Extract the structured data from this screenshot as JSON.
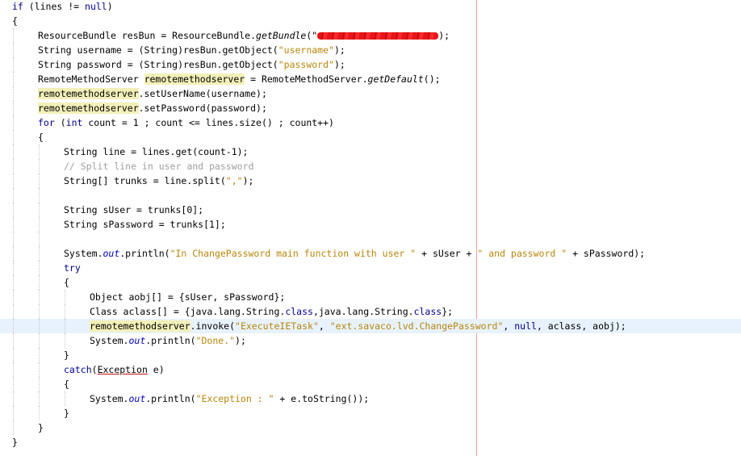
{
  "editor": {
    "lines": [
      {
        "indent": 0,
        "parts": [
          {
            "k": "kw",
            "t": "if"
          },
          {
            "k": "",
            "t": " (lines != "
          },
          {
            "k": "kw",
            "t": "null"
          },
          {
            "k": "",
            "t": ")"
          }
        ]
      },
      {
        "indent": 0,
        "parts": [
          {
            "k": "",
            "t": "{"
          }
        ]
      },
      {
        "indent": 1,
        "parts": [
          {
            "k": "",
            "t": "ResourceBundle resBun = ResourceBundle."
          },
          {
            "k": "it",
            "t": "getBundle"
          },
          {
            "k": "",
            "t": "(\""
          },
          {
            "k": "redact",
            "t": ""
          },
          {
            "k": "",
            "t": ");"
          }
        ]
      },
      {
        "indent": 1,
        "parts": [
          {
            "k": "",
            "t": "String username = (String)resBun.getObject("
          },
          {
            "k": "str",
            "t": "\"username\""
          },
          {
            "k": "",
            "t": ");"
          }
        ]
      },
      {
        "indent": 1,
        "parts": [
          {
            "k": "",
            "t": "String password = (String)resBun.getObject("
          },
          {
            "k": "str",
            "t": "\"password\""
          },
          {
            "k": "",
            "t": ");"
          }
        ]
      },
      {
        "indent": 1,
        "parts": [
          {
            "k": "",
            "t": "RemoteMethodServer "
          },
          {
            "k": "occ",
            "t": "remotemethodserver"
          },
          {
            "k": "",
            "t": " = RemoteMethodServer."
          },
          {
            "k": "it",
            "t": "getDefault"
          },
          {
            "k": "",
            "t": "();"
          }
        ]
      },
      {
        "indent": 1,
        "parts": [
          {
            "k": "occ",
            "t": "remotemethodserver"
          },
          {
            "k": "",
            "t": ".setUserName(username);"
          }
        ]
      },
      {
        "indent": 1,
        "parts": [
          {
            "k": "occ",
            "t": "remotemethodserver"
          },
          {
            "k": "",
            "t": ".setPassword(password);"
          }
        ]
      },
      {
        "indent": 1,
        "parts": [
          {
            "k": "kw",
            "t": "for"
          },
          {
            "k": "",
            "t": " ("
          },
          {
            "k": "kw",
            "t": "int"
          },
          {
            "k": "",
            "t": " count = 1 ; count <= lines.size() ; count++)"
          }
        ]
      },
      {
        "indent": 1,
        "parts": [
          {
            "k": "",
            "t": "{"
          }
        ]
      },
      {
        "indent": 2,
        "parts": [
          {
            "k": "",
            "t": "String line = lines.get(count-1);"
          }
        ]
      },
      {
        "indent": 2,
        "parts": [
          {
            "k": "cmt",
            "t": "// Split line in user and password"
          }
        ]
      },
      {
        "indent": 2,
        "parts": [
          {
            "k": "",
            "t": "String[] trunks = line.split("
          },
          {
            "k": "str",
            "t": "\",\""
          },
          {
            "k": "",
            "t": ");"
          }
        ]
      },
      {
        "indent": 2,
        "parts": [
          {
            "k": "",
            "t": ""
          }
        ]
      },
      {
        "indent": 2,
        "parts": [
          {
            "k": "",
            "t": "String sUser = trunks[0];"
          }
        ]
      },
      {
        "indent": 2,
        "parts": [
          {
            "k": "",
            "t": "String sPassword = trunks[1];"
          }
        ]
      },
      {
        "indent": 2,
        "parts": [
          {
            "k": "",
            "t": ""
          }
        ]
      },
      {
        "indent": 2,
        "parts": [
          {
            "k": "",
            "t": "System."
          },
          {
            "k": "fld",
            "t": "out"
          },
          {
            "k": "",
            "t": ".println("
          },
          {
            "k": "str",
            "t": "\"In ChangePassword main function with user \""
          },
          {
            "k": "",
            "t": " + sUser + "
          },
          {
            "k": "str",
            "t": "\" and password \""
          },
          {
            "k": "",
            "t": " + sPassword);"
          }
        ]
      },
      {
        "indent": 2,
        "parts": [
          {
            "k": "kw",
            "t": "try"
          }
        ]
      },
      {
        "indent": 2,
        "parts": [
          {
            "k": "",
            "t": "{"
          }
        ]
      },
      {
        "indent": 3,
        "parts": [
          {
            "k": "",
            "t": "Object aobj[] = {sUser, sPassword};"
          }
        ]
      },
      {
        "indent": 3,
        "parts": [
          {
            "k": "",
            "t": "Class aclass[] = {java.lang.String."
          },
          {
            "k": "kw",
            "t": "class"
          },
          {
            "k": "",
            "t": ",java.lang.String."
          },
          {
            "k": "kw",
            "t": "class"
          },
          {
            "k": "",
            "t": "};"
          }
        ]
      },
      {
        "indent": 3,
        "current": true,
        "parts": [
          {
            "k": "occ",
            "t": "remotemethodserver"
          },
          {
            "k": "",
            "t": ".invoke("
          },
          {
            "k": "str",
            "t": "\"ExecuteIETask\""
          },
          {
            "k": "",
            "t": ", "
          },
          {
            "k": "str",
            "t": "\"ext.savaco.lvd.ChangePassword\""
          },
          {
            "k": "",
            "t": ", "
          },
          {
            "k": "kw",
            "t": "null"
          },
          {
            "k": "",
            "t": ", aclass, aobj);"
          }
        ]
      },
      {
        "indent": 3,
        "parts": [
          {
            "k": "",
            "t": "System."
          },
          {
            "k": "fld",
            "t": "out"
          },
          {
            "k": "",
            "t": ".println("
          },
          {
            "k": "str",
            "t": "\"Done.\""
          },
          {
            "k": "",
            "t": ");"
          }
        ]
      },
      {
        "indent": 2,
        "parts": [
          {
            "k": "",
            "t": "}"
          }
        ]
      },
      {
        "indent": 2,
        "parts": [
          {
            "k": "kw",
            "t": "catch"
          },
          {
            "k": "",
            "t": "("
          },
          {
            "k": "err",
            "t": "Exception"
          },
          {
            "k": "",
            "t": " e)"
          }
        ]
      },
      {
        "indent": 2,
        "parts": [
          {
            "k": "",
            "t": "{"
          }
        ]
      },
      {
        "indent": 3,
        "parts": [
          {
            "k": "",
            "t": "System."
          },
          {
            "k": "fld",
            "t": "out"
          },
          {
            "k": "",
            "t": ".println("
          },
          {
            "k": "str",
            "t": "\"Exception : \""
          },
          {
            "k": "",
            "t": " + e.toString());"
          }
        ]
      },
      {
        "indent": 2,
        "parts": [
          {
            "k": "",
            "t": "}"
          }
        ]
      },
      {
        "indent": 1,
        "parts": [
          {
            "k": "",
            "t": "}"
          }
        ]
      },
      {
        "indent": 0,
        "parts": [
          {
            "k": "",
            "t": "}"
          }
        ]
      }
    ]
  },
  "colors": {
    "keyword": "#00008b",
    "string": "#b8860b",
    "comment": "#a0a0a0",
    "occurrence": "#f2f0b8",
    "current_line": "#e8f2fe",
    "print_margin": "#e8a0a0"
  }
}
